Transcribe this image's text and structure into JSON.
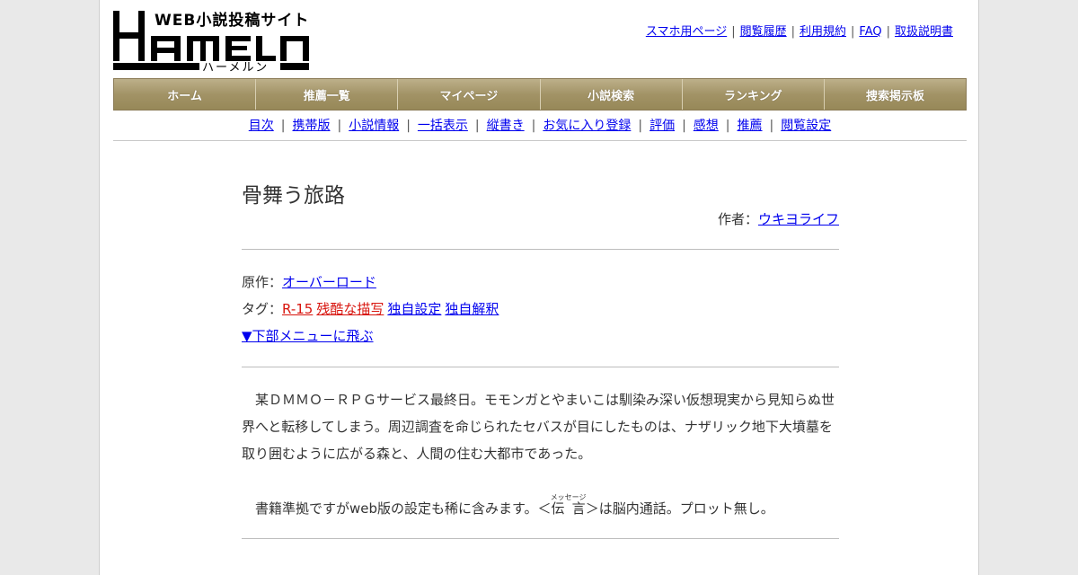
{
  "site": {
    "logo_tagline": "WEB小説投稿サイト",
    "logo_kana": "ハーメルン"
  },
  "top_links": [
    "スマホ用ページ",
    "閲覧履歴",
    "利用規約",
    "FAQ",
    "取扱説明書"
  ],
  "global_nav": [
    "ホーム",
    "推薦一覧",
    "マイページ",
    "小説検索",
    "ランキング",
    "捜索掲示板"
  ],
  "sub_nav": [
    "目次",
    "携帯版",
    "小説情報",
    "一括表示",
    "縦書き",
    "お気に入り登録",
    "評価",
    "感想",
    "推薦",
    "閲覧設定"
  ],
  "novel": {
    "title": "骨舞う旅路",
    "author_label": "作者：",
    "author": "ウキヨライフ",
    "original_label": "原作：",
    "original": "オーバーロード",
    "tag_label": "タグ：",
    "tags_red": [
      "R-15",
      "残酷な描写"
    ],
    "tags": [
      "独自設定",
      "独自解釈"
    ],
    "jump_link": "▼下部メニューに飛ぶ",
    "summary": "　某ＤＭＭＯ－ＲＰＧサービス最終日。モモンガとやまいこは馴染み深い仮想現実から見知らぬ世界へと転移してしまう。周辺調査を命じられたセバスが目にしたものは、ナザリック地下大墳墓を取り囲むように広がる森と、人間の住む大都市であった。",
    "note_before": "　書籍準拠ですがweb版の設定も稀に含みます。＜",
    "note_ruby_base": "伝 言",
    "note_ruby_text": "メッセージ",
    "note_after": "＞は脳内通話。プロット無し。"
  }
}
